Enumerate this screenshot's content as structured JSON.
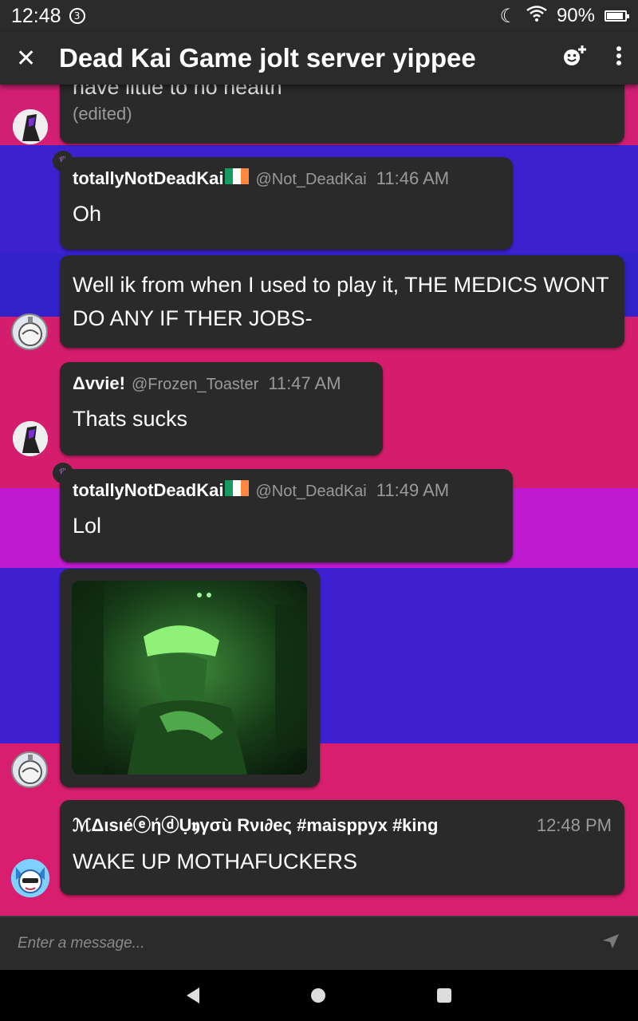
{
  "status_bar": {
    "time": "12:48",
    "notification_count": "3",
    "battery": "90%"
  },
  "header": {
    "title": "Dead Kai Game jolt server yippee"
  },
  "messages": [
    {
      "partial_text": "have little to no health",
      "edited": "(edited)"
    },
    {
      "username": "totallyNotDeadKai",
      "handle": "@Not_DeadKai",
      "time": "11:46 AM",
      "text": "Oh"
    },
    {
      "text": "Well ik from when I used to play it, THE MEDICS WONT DO ANY IF THER JOBS-"
    },
    {
      "username": "Δvvie!",
      "handle": "@Frozen_Toaster",
      "time": "11:47 AM",
      "text": "Thats sucks"
    },
    {
      "username": "totallyNotDeadKai",
      "handle": "@Not_DeadKai",
      "time": "11:49 AM",
      "text": "Lol"
    },
    {
      "image": "gif-green-man"
    },
    {
      "username": "ᄙ𝖠𝖎𝖘𝖎𝖊 ⓔήⓓŌ𝖎𝖟γσù Rνι∂еς",
      "handle": "",
      "username_display": "ℳΔιsιéⓔήⓓỤ𝖞γσù Rνι∂еς #maisppyx #king",
      "time": "12:48 PM",
      "text": "WAKE UP MOTHAFUCKERS"
    }
  ],
  "composer": {
    "placeholder": "Enter a message..."
  },
  "colors": {
    "pink": "#d81e6e",
    "purple": "#c21ccd",
    "blue": "#3e20d0",
    "bubble": "#2a2a2a"
  }
}
